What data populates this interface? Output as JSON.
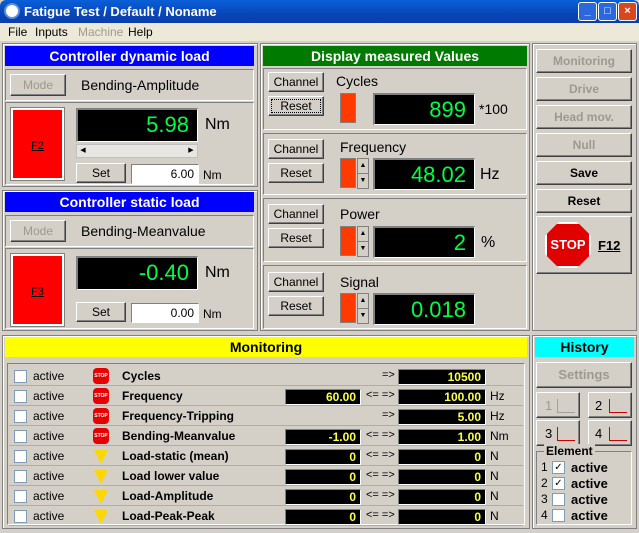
{
  "window": {
    "title": "Fatigue Test / Default / Noname"
  },
  "menu": [
    {
      "label": "File",
      "enabled": true
    },
    {
      "label": "Inputs",
      "enabled": true
    },
    {
      "label": "Machine",
      "enabled": false
    },
    {
      "label": "Help",
      "enabled": true
    }
  ],
  "dynamic": {
    "header": "Controller dynamic load",
    "mode_label": "Mode",
    "mode_value": "Bending-Amplitude",
    "indicator": "F2",
    "value": "5.98",
    "unit": "Nm",
    "set_label": "Set",
    "set_value": "6.00",
    "set_unit": "Nm"
  },
  "static": {
    "header": "Controller static load",
    "mode_label": "Mode",
    "mode_value": "Bending-Meanvalue",
    "indicator": "F3",
    "value": "-0.40",
    "unit": "Nm",
    "set_label": "Set",
    "set_value": "0.00",
    "set_unit": "Nm"
  },
  "display": {
    "header": "Display measured Values",
    "channel_label": "Channel",
    "reset_label": "Reset",
    "items": [
      {
        "name": "Cycles",
        "value": "899",
        "unit": "*100"
      },
      {
        "name": "Frequency",
        "value": "48.02",
        "unit": "Hz"
      },
      {
        "name": "Power",
        "value": "2",
        "unit": "%"
      },
      {
        "name": "Signal",
        "value": "0.018",
        "unit": ""
      }
    ]
  },
  "sidebuttons": {
    "monitoring": "Monitoring",
    "drive": "Drive",
    "head_mov": "Head mov.",
    "null": "Null",
    "save": "Save",
    "reset": "Reset",
    "stop_sign": "STOP",
    "stop_key": "F12"
  },
  "monitoring": {
    "header": "Monitoring",
    "active_label": "active",
    "arrow": "<= =>",
    "rows": [
      {
        "name": "Cycles",
        "icon": "stop",
        "low": "",
        "arrow": "=>",
        "high": "10500",
        "unit": ""
      },
      {
        "name": "Frequency",
        "icon": "stop",
        "low": "60.00",
        "arrow": "<= =>",
        "high": "100.00",
        "unit": "Hz"
      },
      {
        "name": "Frequency-Tripping",
        "icon": "stop",
        "low": "",
        "arrow": "=>",
        "high": "5.00",
        "unit": "Hz"
      },
      {
        "name": "Bending-Meanvalue",
        "icon": "stop",
        "low": "-1.00",
        "arrow": "<= =>",
        "high": "1.00",
        "unit": "Nm"
      },
      {
        "name": "Load-static (mean)",
        "icon": "warn",
        "low": "0",
        "arrow": "<= =>",
        "high": "0",
        "unit": "N"
      },
      {
        "name": "Load lower value",
        "icon": "warn",
        "low": "0",
        "arrow": "<= =>",
        "high": "0",
        "unit": "N"
      },
      {
        "name": "Load-Amplitude",
        "icon": "warn",
        "low": "0",
        "arrow": "<= =>",
        "high": "0",
        "unit": "N"
      },
      {
        "name": "Load-Peak-Peak",
        "icon": "warn",
        "low": "0",
        "arrow": "<= =>",
        "high": "0",
        "unit": "N"
      }
    ]
  },
  "history": {
    "header": "History",
    "settings": "Settings",
    "graph_buttons": [
      "1",
      "2",
      "3",
      "4"
    ],
    "element_label": "Element",
    "elements": [
      {
        "num": "1",
        "label": "active",
        "checked": true
      },
      {
        "num": "2",
        "label": "active",
        "checked": true
      },
      {
        "num": "3",
        "label": "active",
        "checked": false
      },
      {
        "num": "4",
        "label": "active",
        "checked": false
      }
    ]
  }
}
